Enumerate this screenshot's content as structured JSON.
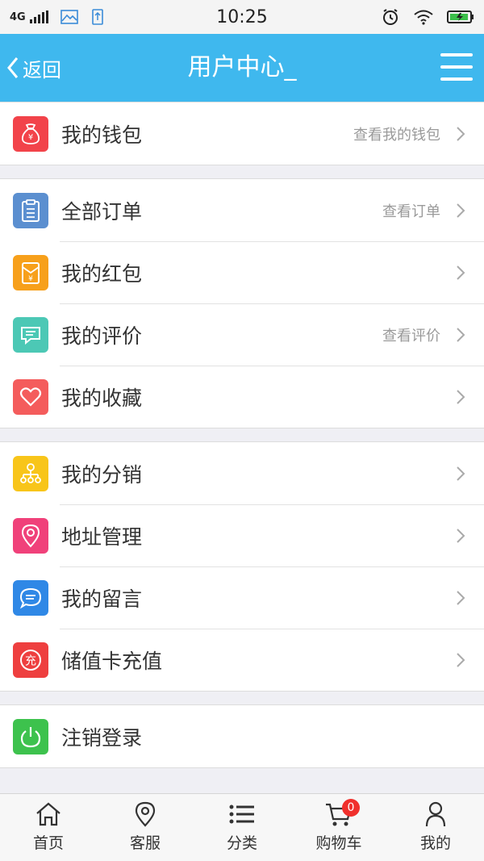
{
  "status_bar": {
    "network": "4G",
    "time": "10:25"
  },
  "nav": {
    "back_label": "返回",
    "title": "用户中心_"
  },
  "groups": [
    {
      "rows": [
        {
          "label": "我的钱包",
          "hint": "查看我的钱包",
          "icon": "wallet-icon",
          "color": "#f2434a"
        }
      ]
    },
    {
      "rows": [
        {
          "label": "全部订单",
          "hint": "查看订单",
          "icon": "clipboard-icon",
          "color": "#5b8fd0"
        },
        {
          "label": "我的红包",
          "hint": "",
          "icon": "red-envelope-icon",
          "color": "#f7a01b"
        },
        {
          "label": "我的评价",
          "hint": "查看评价",
          "icon": "comment-icon",
          "color": "#4cc8b5"
        },
        {
          "label": "我的收藏",
          "hint": "",
          "icon": "heart-icon",
          "color": "#f45c5c"
        }
      ]
    },
    {
      "rows": [
        {
          "label": "我的分销",
          "hint": "",
          "icon": "network-icon",
          "color": "#f8c51a"
        },
        {
          "label": "地址管理",
          "hint": "",
          "icon": "location-pin-icon",
          "color": "#f0417a"
        },
        {
          "label": "我的留言",
          "hint": "",
          "icon": "message-icon",
          "color": "#2f88e6"
        },
        {
          "label": "储值卡充值",
          "hint": "",
          "icon": "recharge-icon",
          "color": "#ee3f3f"
        }
      ]
    },
    {
      "rows": [
        {
          "label": "注销登录",
          "hint": "",
          "icon": "power-icon",
          "color": "#3dc24d"
        }
      ]
    }
  ],
  "tabbar": {
    "tabs": [
      {
        "label": "首页",
        "icon": "home-icon"
      },
      {
        "label": "客服",
        "icon": "location-icon"
      },
      {
        "label": "分类",
        "icon": "list-icon"
      },
      {
        "label": "购物车",
        "icon": "cart-icon",
        "badge": "0"
      },
      {
        "label": "我的",
        "icon": "user-icon"
      }
    ]
  },
  "colors": {
    "nav_bg": "#3fb8ee",
    "page_bg": "#efeff4",
    "badge": "#f0302c"
  }
}
